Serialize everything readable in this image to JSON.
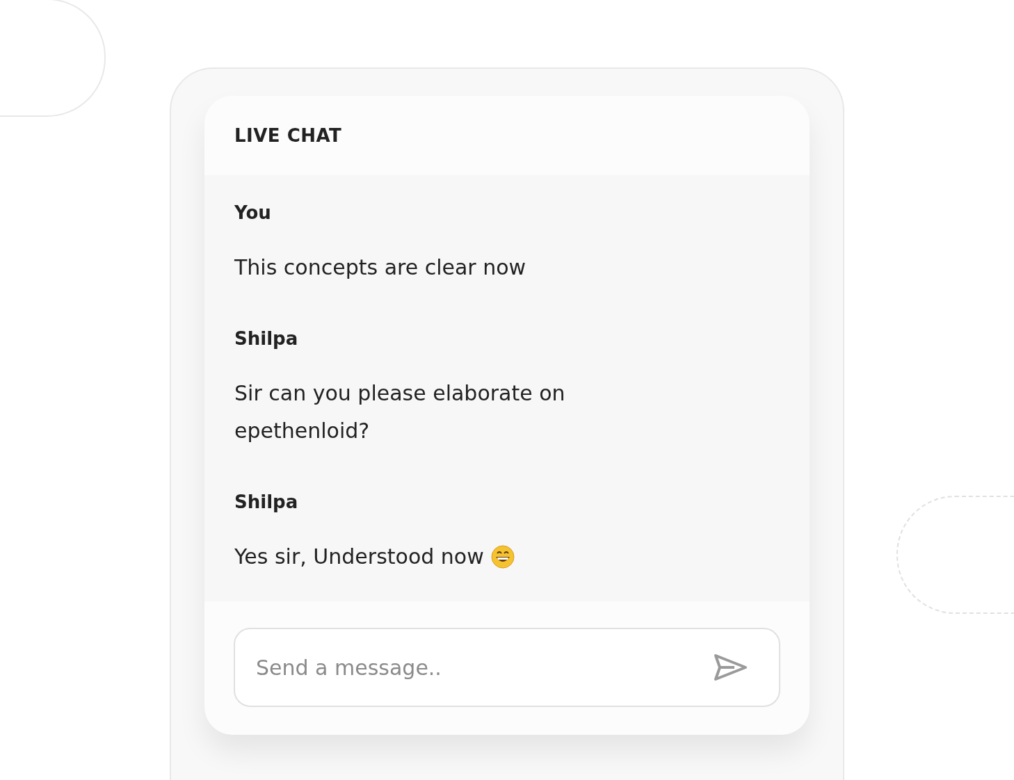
{
  "chat": {
    "title": "LIVE CHAT",
    "messages": [
      {
        "sender": "You",
        "text": "This concepts are clear now",
        "has_emoji": false
      },
      {
        "sender": "Shilpa",
        "text": "Sir can you please elaborate on epethenloid?",
        "has_emoji": false
      },
      {
        "sender": "Shilpa",
        "text": "Yes sir, Understood now",
        "has_emoji": true
      }
    ],
    "input": {
      "placeholder": "Send a message.."
    }
  }
}
